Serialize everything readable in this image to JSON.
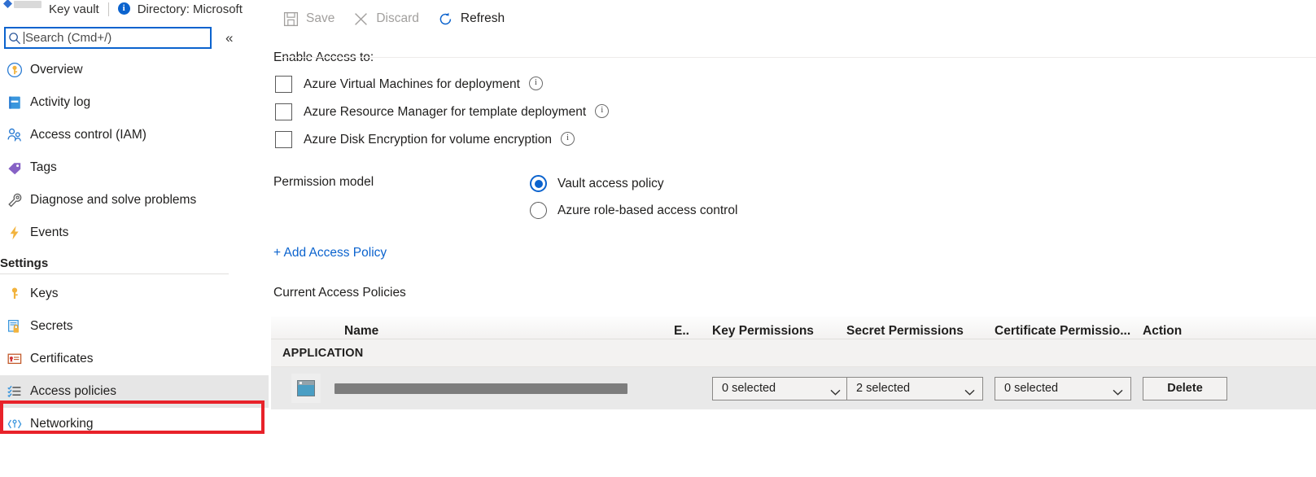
{
  "breadcrumb": {
    "resource_type": "Key vault",
    "directory": "Directory: Microsoft",
    "info_glyph": "i"
  },
  "search": {
    "placeholder": "Search (Cmd+/)",
    "value": "",
    "icon": "search-icon",
    "collapse_icon": "«"
  },
  "sidebar": {
    "items": [
      {
        "label": "Overview",
        "icon": "key-circle-icon",
        "selected": false
      },
      {
        "label": "Activity log",
        "icon": "activity-log-icon",
        "selected": false
      },
      {
        "label": "Access control (IAM)",
        "icon": "people-icon",
        "selected": false
      },
      {
        "label": "Tags",
        "icon": "tag-icon",
        "selected": false
      },
      {
        "label": "Diagnose and solve problems",
        "icon": "wrench-icon",
        "selected": false
      },
      {
        "label": "Events",
        "icon": "lightning-icon",
        "selected": false
      }
    ],
    "section_title": "Settings",
    "settings_items": [
      {
        "label": "Keys",
        "icon": "key-icon",
        "selected": false
      },
      {
        "label": "Secrets",
        "icon": "secret-lock-icon",
        "selected": false
      },
      {
        "label": "Certificates",
        "icon": "certificate-icon",
        "selected": false
      },
      {
        "label": "Access policies",
        "icon": "access-policies-icon",
        "selected": true
      },
      {
        "label": "Networking",
        "icon": "networking-icon",
        "selected": false
      }
    ],
    "highlight_color": "#e8222a"
  },
  "toolbar": {
    "buttons": [
      {
        "label": "Save",
        "icon": "save-icon",
        "enabled": false
      },
      {
        "label": "Discard",
        "icon": "discard-icon",
        "enabled": false
      },
      {
        "label": "Refresh",
        "icon": "refresh-icon",
        "enabled": true
      }
    ]
  },
  "main": {
    "enable_access_label": "Enable Access to:",
    "checkboxes": [
      {
        "label": "Azure Virtual Machines for deployment",
        "checked": false,
        "info": true
      },
      {
        "label": "Azure Resource Manager for template deployment",
        "checked": false,
        "info": true
      },
      {
        "label": "Azure Disk Encryption for volume encryption",
        "checked": false,
        "info": true
      }
    ],
    "permission_model_label": "Permission model",
    "permission_options": [
      {
        "label": "Vault access policy",
        "selected": true
      },
      {
        "label": "Azure role-based access control",
        "selected": false
      }
    ],
    "add_policy_link": "+ Add Access Policy",
    "current_policies_label": "Current Access Policies",
    "table": {
      "columns": [
        "Name",
        "E..",
        "Key Permissions",
        "Secret Permissions",
        "Certificate Permissio...",
        "Action"
      ],
      "groups": [
        {
          "name": "APPLICATION",
          "rows": [
            {
              "name": "",
              "name_redacted": true,
              "icon": "application-icon",
              "email": "",
              "key_permissions": "0 selected",
              "secret_permissions": "2 selected",
              "certificate_permissions": "0 selected",
              "action": "Delete"
            }
          ]
        }
      ]
    }
  },
  "colors": {
    "accent": "#0b63ce",
    "link": "#0b63ce",
    "highlight": "#e8222a",
    "row_bg": "#e9e9e9"
  }
}
